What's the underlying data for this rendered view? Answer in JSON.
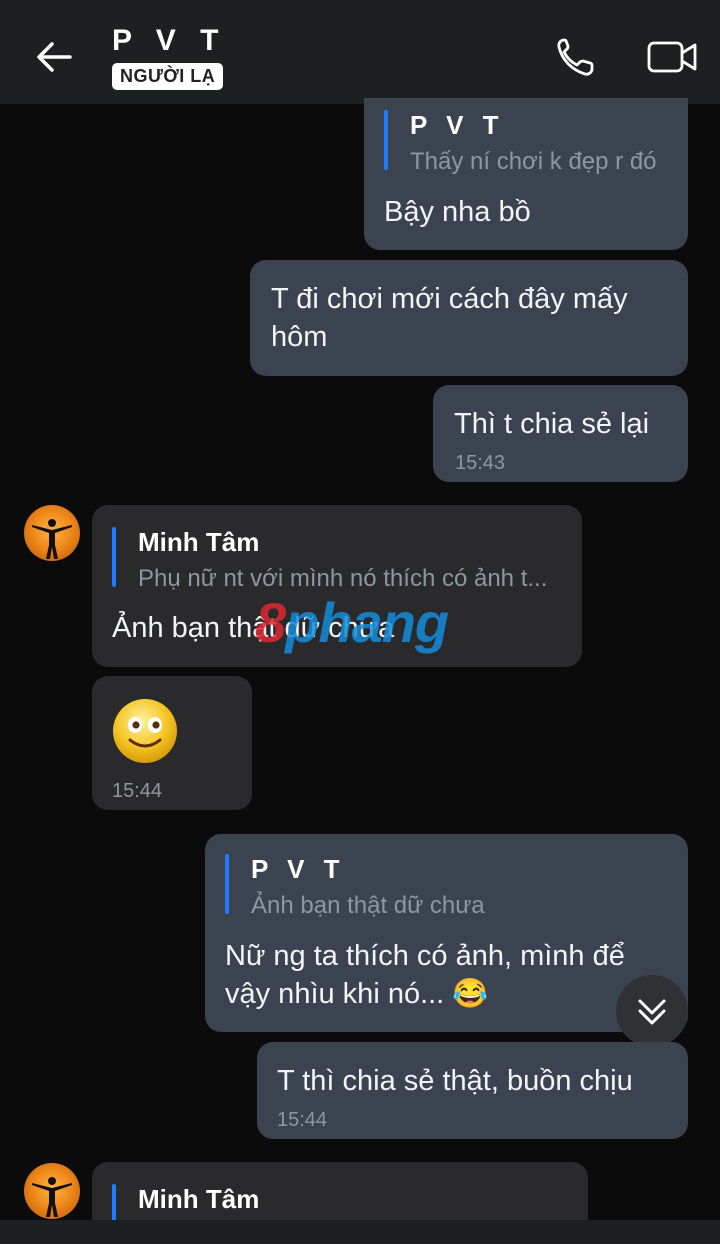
{
  "header": {
    "title": "P V T",
    "badge": "NGƯỜI LẠ"
  },
  "messages": {
    "m1": {
      "quote_name": "P V T",
      "quote_text": "Thấy ní chơi k đẹp r đó",
      "text": "Bậy nha bồ"
    },
    "m2": {
      "text_line1": "T đi chơi mới cách đây mấy",
      "text_line2": "hôm"
    },
    "m3": {
      "text": "Thì t chia sẻ lại",
      "time": "15:43"
    },
    "m4": {
      "quote_name": "Minh Tâm",
      "quote_text": "Phụ nữ nt với mình nó thích có ảnh t...",
      "text": "Ảnh bạn thật dữ chưa"
    },
    "m5": {
      "emoji": "🙂",
      "time": "15:44"
    },
    "m6": {
      "quote_name": "P V T",
      "quote_text": "Ảnh bạn thật dữ chưa",
      "text_line1": "Nữ ng ta thích có ảnh, mình để",
      "text_line2": "vậy nhìu khi nó... 😂"
    },
    "m7": {
      "text": "T thì chia sẻ thật, buồn chịu",
      "time": "15:44"
    },
    "m8": {
      "quote_name": "Minh Tâm"
    }
  },
  "watermark": {
    "part1": "8",
    "part2": "phang"
  },
  "colors": {
    "accent": "#1f7bff",
    "outgoing_bubble": "#3b4350",
    "incoming_bubble": "#2a2a2d",
    "background": "#0b0b0c"
  },
  "icons": [
    "back-arrow-icon",
    "phone-icon",
    "video-camera-icon",
    "chevron-double-down-icon"
  ]
}
